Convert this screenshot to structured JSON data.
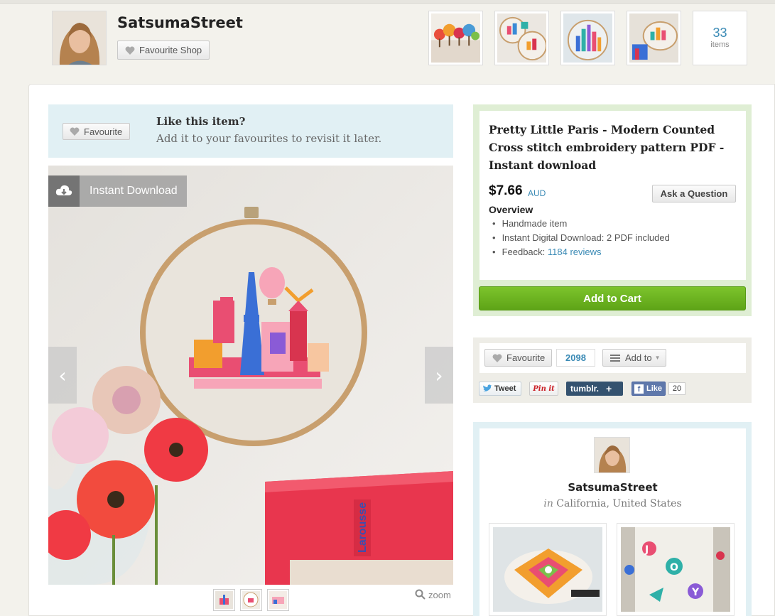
{
  "shop": {
    "name": "SatsumaStreet",
    "favourite_label": "Favourite Shop",
    "items_count": "33",
    "items_label": "items"
  },
  "like_box": {
    "button_label": "Favourite",
    "title": "Like this item?",
    "subtitle": "Add it to your favourites to revisit it later."
  },
  "gallery": {
    "badge_label": "Instant Download",
    "zoom_label": "zoom"
  },
  "listing": {
    "title": "Pretty Little Paris - Modern Counted Cross stitch embroidery pattern PDF - Instant download",
    "price": "$7.66",
    "currency": "AUD",
    "ask_label": "Ask a Question",
    "overview_heading": "Overview",
    "overview_items": [
      {
        "text": "Handmade item",
        "link": ""
      },
      {
        "text": "Instant Digital Download: 2 PDF included",
        "link": ""
      },
      {
        "text": "Feedback: ",
        "link": "1184 reviews"
      }
    ],
    "cart_label": "Add to Cart"
  },
  "social": {
    "favourite_label": "Favourite",
    "favourite_count": "2098",
    "add_to_label": "Add to",
    "tweet_label": "Tweet",
    "pinit_label": "Pin it",
    "tumblr_label": "tumblr.",
    "like_label": "Like",
    "like_count": "20"
  },
  "seller": {
    "name": "SatsumaStreet",
    "location_prefix": "in",
    "location": "California, United States"
  },
  "colors": {
    "accent_blue": "#3a8ab5",
    "cart_green": "#6bb420",
    "like_bg": "#e1f0f4",
    "buy_bg": "#dfeed4"
  }
}
